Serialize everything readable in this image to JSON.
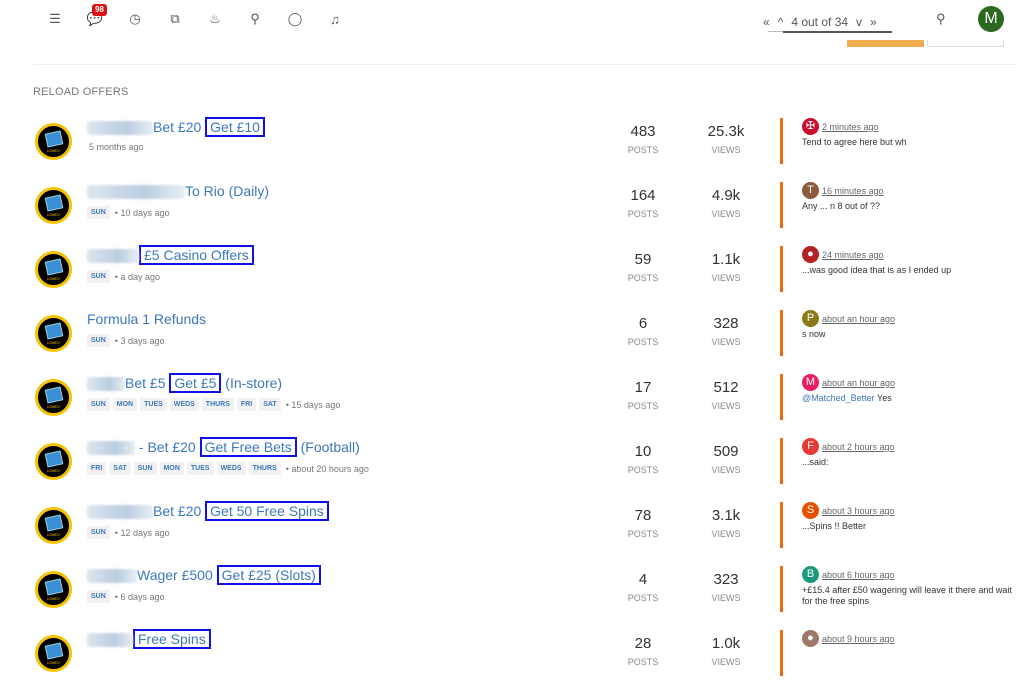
{
  "topbar": {
    "icons": [
      {
        "name": "unread-list-icon",
        "glyph": "☰"
      },
      {
        "name": "chat-icon",
        "glyph": "💬",
        "badge": "98"
      },
      {
        "name": "recent-clock-icon",
        "glyph": "◷"
      },
      {
        "name": "tags-icon",
        "glyph": "⧉"
      },
      {
        "name": "popular-fire-icon",
        "glyph": "♨"
      },
      {
        "name": "search-icon",
        "glyph": "⚲"
      },
      {
        "name": "comment-icon",
        "glyph": "◯"
      },
      {
        "name": "bell-icon",
        "glyph": "♫"
      }
    ],
    "pagination": {
      "first": "«",
      "prev": "^",
      "label": "4 out of 34",
      "next": "v",
      "last": "»"
    },
    "search_glyph": "⚲",
    "user_initial": "M"
  },
  "category": {
    "title": "RELOAD OFFERS"
  },
  "topics": [
    {
      "title_pre": "Bet £20 ",
      "title_hl": "Get £10",
      "title_post": "",
      "blur_w": 66,
      "tags": [],
      "time": "5 months ago",
      "posts": "483",
      "views": "25.3k",
      "last_time": "2 minutes ago",
      "last_av_color": "#c8102e",
      "last_av_letter": "✠",
      "last_text": "Tend to agree here but wh",
      "last_mention": ""
    },
    {
      "title_pre": "To Rio (Daily)",
      "title_hl": "",
      "title_post": "",
      "blur_w": 98,
      "tags": [
        "SUN"
      ],
      "time": "10 days ago",
      "posts": "164",
      "views": "4.9k",
      "last_time": "16 minutes ago",
      "last_av_color": "#8b5a3c",
      "last_av_letter": "T",
      "last_text": "Any ... n 8 out of ??",
      "last_mention": ""
    },
    {
      "title_pre": "",
      "title_hl": "£5 Casino Offers",
      "title_post": "",
      "blur_w": 52,
      "tags": [
        "SUN"
      ],
      "time": "a day ago",
      "posts": "59",
      "views": "1.1k",
      "last_time": "24 minutes ago",
      "last_av_color": "#b22222",
      "last_av_letter": "●",
      "last_text": "...was good idea that is as I ended up",
      "last_mention": ""
    },
    {
      "title_pre": "Formula 1 Refunds",
      "title_hl": "",
      "title_post": "",
      "blur_w": 0,
      "tags": [
        "SUN"
      ],
      "time": "3 days ago",
      "posts": "6",
      "views": "328",
      "last_time": "about an hour ago",
      "last_av_color": "#8a7a1a",
      "last_av_letter": "P",
      "last_text": "s now",
      "last_mention": ""
    },
    {
      "title_pre": "Bet £5 ",
      "title_hl": "Get £5",
      "title_post": " (In-store)",
      "blur_w": 38,
      "tags": [
        "SUN",
        "MON",
        "TUES",
        "WEDS",
        "THURS",
        "FRI",
        "SAT"
      ],
      "time": "15 days ago",
      "posts": "17",
      "views": "512",
      "last_time": "about an hour ago",
      "last_av_color": "#e91e63",
      "last_av_letter": "M",
      "last_text": " Yes",
      "last_mention": "@Matched_Better"
    },
    {
      "title_pre": " - Bet £20 ",
      "title_hl": "Get Free Bets",
      "title_post": " (Football)",
      "blur_w": 48,
      "tags": [
        "FRI",
        "SAT",
        "SUN",
        "MON",
        "TUES",
        "WEDS",
        "THURS"
      ],
      "time": "about 20 hours ago",
      "posts": "10",
      "views": "509",
      "last_time": "about 2 hours ago",
      "last_av_color": "#e53935",
      "last_av_letter": "F",
      "last_text": "...said:",
      "last_mention": ""
    },
    {
      "title_pre": "Bet £20 ",
      "title_hl": "Get 50 Free Spins",
      "title_post": "",
      "blur_w": 66,
      "tags": [
        "SUN"
      ],
      "time": "12 days ago",
      "posts": "78",
      "views": "3.1k",
      "last_time": "about 3 hours ago",
      "last_av_color": "#e65100",
      "last_av_letter": "S",
      "last_text": "...Spins !! Better",
      "last_mention": ""
    },
    {
      "title_pre": "Wager £500 ",
      "title_hl": "Get £25 (Slots)",
      "title_post": "",
      "blur_w": 50,
      "tags": [
        "SUN"
      ],
      "time": "6 days ago",
      "posts": "4",
      "views": "323",
      "last_time": "about 6 hours ago",
      "last_av_color": "#1a9a7a",
      "last_av_letter": "B",
      "last_text": "+£15.4 after £50 wagering will leave it there and wait for the free spins",
      "last_mention": ""
    },
    {
      "title_pre": "",
      "title_hl": "Free Spins",
      "title_post": "",
      "blur_w": 46,
      "tags": [],
      "time": "",
      "posts": "28",
      "views": "1.0k",
      "last_time": "about 9 hours ago",
      "last_av_color": "#a0786a",
      "last_av_letter": "●",
      "last_text": "",
      "last_mention": ""
    }
  ],
  "labels": {
    "posts": "POSTS",
    "views": "VIEWS"
  }
}
